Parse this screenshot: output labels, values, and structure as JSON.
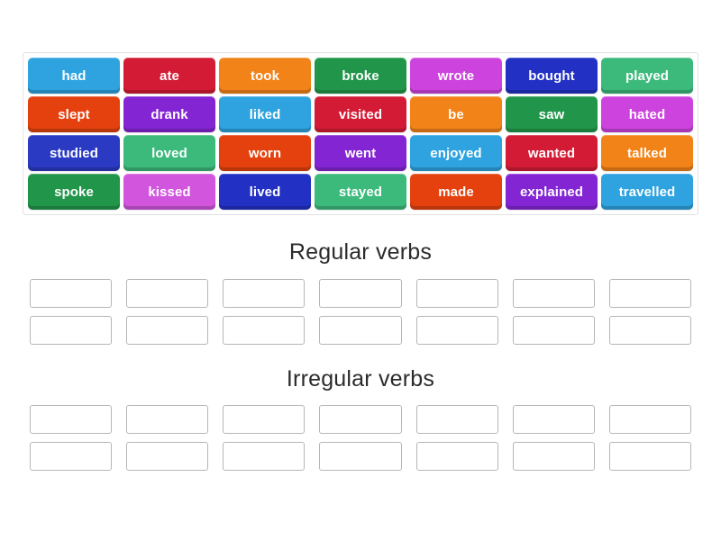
{
  "page": {
    "background_color": "#ffffff",
    "activity_type": "group-sort"
  },
  "wordbank": {
    "name": "word-bank",
    "border_color": "#e2e2e2",
    "tiles": [
      {
        "label": "had",
        "color": "#2ea3e0"
      },
      {
        "label": "ate",
        "color": "#d31b35"
      },
      {
        "label": "took",
        "color": "#f28318"
      },
      {
        "label": "broke",
        "color": "#21964a"
      },
      {
        "label": "wrote",
        "color": "#cc44dd"
      },
      {
        "label": "bought",
        "color": "#2231c4"
      },
      {
        "label": "played",
        "color": "#3cba7c"
      },
      {
        "label": "slept",
        "color": "#e5410e"
      },
      {
        "label": "drank",
        "color": "#8425d4"
      },
      {
        "label": "liked",
        "color": "#2ea3e0"
      },
      {
        "label": "visited",
        "color": "#d31b35"
      },
      {
        "label": "be",
        "color": "#f28318"
      },
      {
        "label": "saw",
        "color": "#21964a"
      },
      {
        "label": "hated",
        "color": "#cc44dd"
      },
      {
        "label": "studied",
        "color": "#2b3ac2"
      },
      {
        "label": "loved",
        "color": "#3cba7c"
      },
      {
        "label": "worn",
        "color": "#e5410e"
      },
      {
        "label": "went",
        "color": "#8425d4"
      },
      {
        "label": "enjoyed",
        "color": "#2ea3e0"
      },
      {
        "label": "wanted",
        "color": "#d31b35"
      },
      {
        "label": "talked",
        "color": "#f28318"
      },
      {
        "label": "spoke",
        "color": "#21964a"
      },
      {
        "label": "kissed",
        "color": "#d155dd"
      },
      {
        "label": "lived",
        "color": "#2231c4"
      },
      {
        "label": "stayed",
        "color": "#3cba7c"
      },
      {
        "label": "made",
        "color": "#e5410e"
      },
      {
        "label": "explained",
        "color": "#8425d4"
      },
      {
        "label": "travelled",
        "color": "#2ea3e0"
      }
    ]
  },
  "groups": [
    {
      "title": "Regular verbs",
      "slot_count": 14,
      "slots": [
        "",
        "",
        "",
        "",
        "",
        "",
        "",
        "",
        "",
        "",
        "",
        "",
        "",
        ""
      ]
    },
    {
      "title": "Irregular verbs",
      "slot_count": 14,
      "slots": [
        "",
        "",
        "",
        "",
        "",
        "",
        "",
        "",
        "",
        "",
        "",
        "",
        "",
        ""
      ]
    }
  ],
  "colors": {
    "dropzone_border": "#b6b6b6",
    "heading_text": "#2b2b2b",
    "tile_text": "#ffffff"
  }
}
